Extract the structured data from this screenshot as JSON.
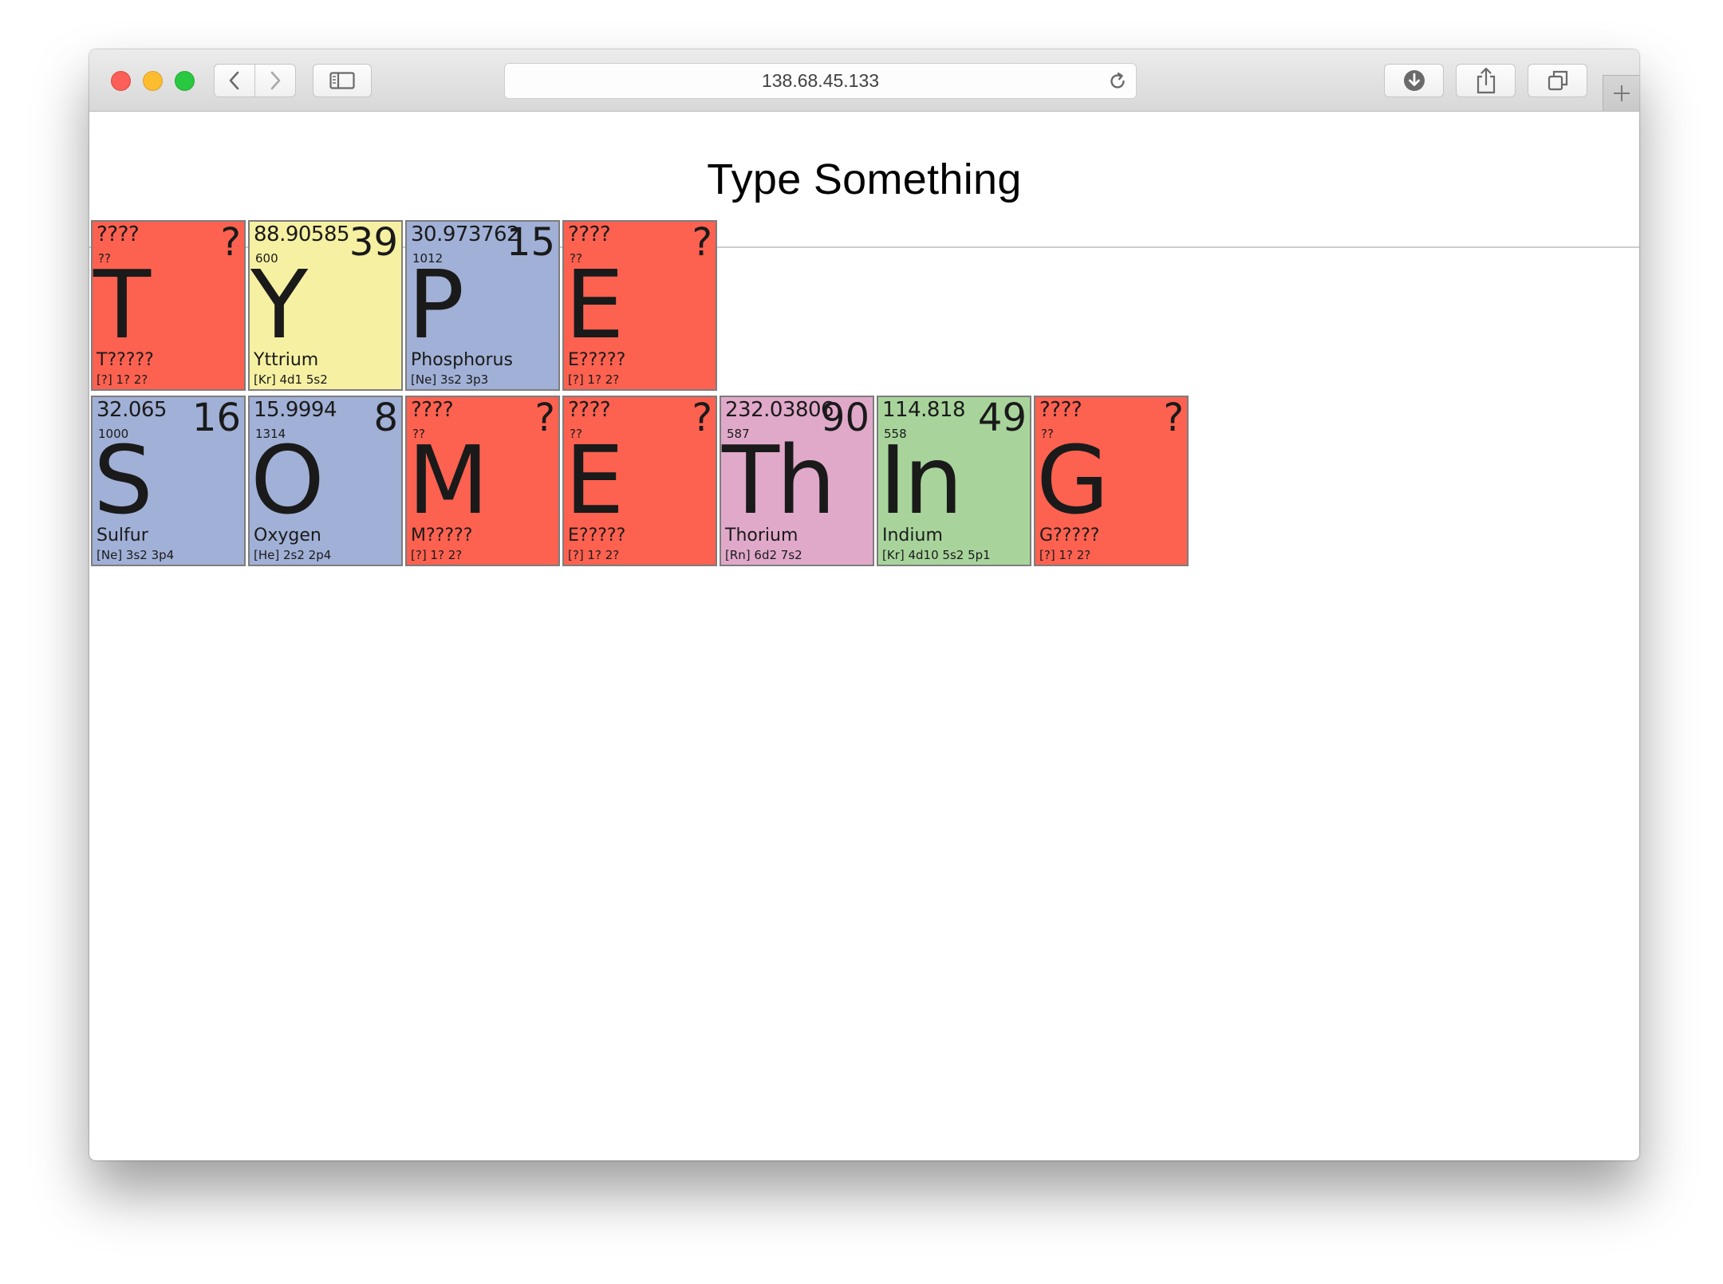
{
  "browser": {
    "url": "138.68.45.133",
    "icons": {
      "back": "chevron-left-icon",
      "forward": "chevron-right-icon",
      "sidebar": "sidebar-icon",
      "reload": "reload-icon",
      "downloads": "download-icon",
      "share": "share-icon",
      "tabs": "tabs-icon",
      "new_tab": "plus-icon"
    }
  },
  "page": {
    "title": "Type Something"
  },
  "colors": {
    "unknown": "#fd6150",
    "transition_metal": "#f6f0a2",
    "nonmetal": "#a1b0d6",
    "actinide": "#e0a9c9",
    "post_transition_metal": "#a8d49c"
  },
  "rows": [
    [
      {
        "mass": "????",
        "number": "?",
        "sub": "??",
        "symbol": "T",
        "name": "T?????",
        "config": "[?] 1? 2?",
        "color": "#fd6150"
      },
      {
        "mass": "88.90585",
        "number": "39",
        "sub": "600",
        "symbol": "Y",
        "name": "Yttrium",
        "config": "[Kr] 4d1 5s2",
        "color": "#f6f0a2"
      },
      {
        "mass": "30.973762",
        "number": "15",
        "sub": "1012",
        "symbol": "P",
        "name": "Phosphorus",
        "config": "[Ne] 3s2 3p3",
        "color": "#a1b0d6"
      },
      {
        "mass": "????",
        "number": "?",
        "sub": "??",
        "symbol": "E",
        "name": "E?????",
        "config": "[?] 1? 2?",
        "color": "#fd6150"
      }
    ],
    [
      {
        "mass": "32.065",
        "number": "16",
        "sub": "1000",
        "symbol": "S",
        "name": "Sulfur",
        "config": "[Ne] 3s2 3p4",
        "color": "#a1b0d6"
      },
      {
        "mass": "15.9994",
        "number": "8",
        "sub": "1314",
        "symbol": "O",
        "name": "Oxygen",
        "config": "[He] 2s2 2p4",
        "color": "#a1b0d6"
      },
      {
        "mass": "????",
        "number": "?",
        "sub": "??",
        "symbol": "M",
        "name": "M?????",
        "config": "[?] 1? 2?",
        "color": "#fd6150"
      },
      {
        "mass": "????",
        "number": "?",
        "sub": "??",
        "symbol": "E",
        "name": "E?????",
        "config": "[?] 1? 2?",
        "color": "#fd6150"
      },
      {
        "mass": "232.03806",
        "number": "90",
        "sub": "587",
        "symbol": "Th",
        "name": "Thorium",
        "config": "[Rn] 6d2 7s2",
        "color": "#e0a9c9"
      },
      {
        "mass": "114.818",
        "number": "49",
        "sub": "558",
        "symbol": "In",
        "name": "Indium",
        "config": "[Kr] 4d10 5s2 5p1",
        "color": "#a8d49c"
      },
      {
        "mass": "????",
        "number": "?",
        "sub": "??",
        "symbol": "G",
        "name": "G?????",
        "config": "[?] 1? 2?",
        "color": "#fd6150"
      }
    ]
  ]
}
